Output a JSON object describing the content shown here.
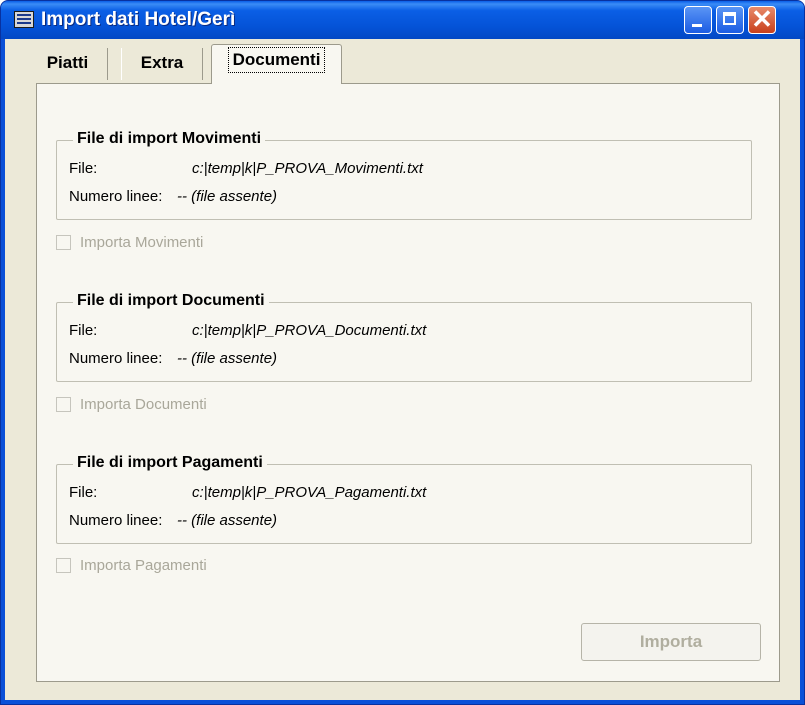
{
  "window": {
    "title": "Import dati Hotel/Gerì",
    "icons": {
      "app": "app-window-icon",
      "minimize": "minimize-icon",
      "maximize": "maximize-icon",
      "close": "close-icon"
    },
    "close_glyph": "✕"
  },
  "tabs": [
    {
      "label": "Piatti",
      "active": false
    },
    {
      "label": "Extra",
      "active": false
    },
    {
      "label": "Documenti",
      "active": true
    }
  ],
  "groups": [
    {
      "title": "File di import Movimenti",
      "file_label": "File:",
      "file_value": "c:|temp|k|P_PROVA_Movimenti.txt",
      "lines_label": "Numero linee:",
      "lines_value": "-- (file assente)",
      "checkbox_label": "Importa Movimenti",
      "checked": false
    },
    {
      "title": "File di import Documenti",
      "file_label": "File:",
      "file_value": "c:|temp|k|P_PROVA_Documenti.txt",
      "lines_label": "Numero linee:",
      "lines_value": "-- (file assente)",
      "checkbox_label": "Importa Documenti",
      "checked": false
    },
    {
      "title": "File di import Pagamenti",
      "file_label": "File:",
      "file_value": "c:|temp|k|P_PROVA_Pagamenti.txt",
      "lines_label": "Numero linee:",
      "lines_value": "-- (file assente)",
      "checkbox_label": "Importa Pagamenti",
      "checked": false
    }
  ],
  "actions": {
    "import_label": "Importa",
    "import_enabled": false
  },
  "colors": {
    "titlebar": "#0452d6",
    "client_bg": "#ece9d8",
    "panel_bg": "#f8f7f1",
    "disabled_text": "#a9a79a"
  }
}
